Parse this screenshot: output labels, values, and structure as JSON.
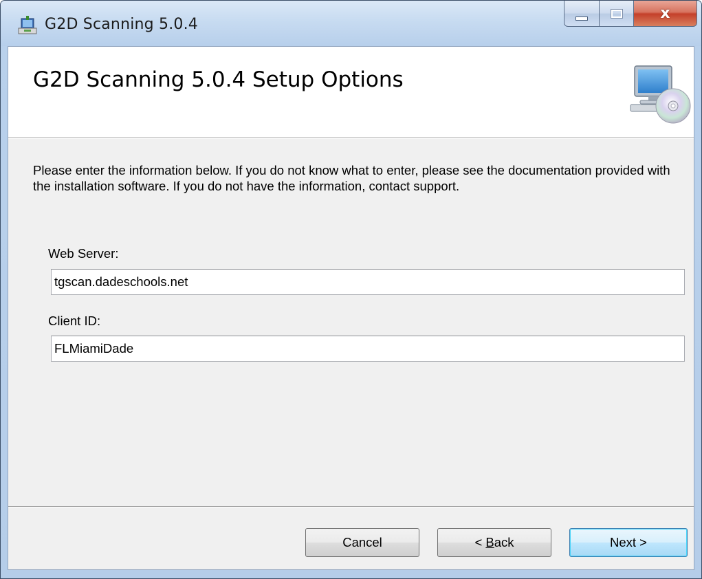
{
  "window": {
    "title": "G2D Scanning 5.0.4",
    "controls": {
      "minimize": "minimize",
      "maximize": "maximize",
      "close": "x"
    }
  },
  "banner": {
    "heading": "G2D Scanning 5.0.4 Setup Options",
    "icon": "computer-disc-icon"
  },
  "instructions": "Please enter the information below. If you do not know what to enter, please see the documentation provided with the installation software. If you do not have the information, contact support.",
  "form": {
    "web_server": {
      "label": "Web Server:",
      "value": "tgscan.dadeschools.net"
    },
    "client_id": {
      "label": "Client ID:",
      "value": "FLMiamiDade"
    }
  },
  "buttons": {
    "cancel": "Cancel",
    "back_prefix": "< ",
    "back_accel": "B",
    "back_rest": "ack",
    "next": "Next >"
  },
  "colors": {
    "accent_default_button": "#3c7fb1",
    "titlebar": "#c7dbf1",
    "close_button": "#c4402a"
  }
}
